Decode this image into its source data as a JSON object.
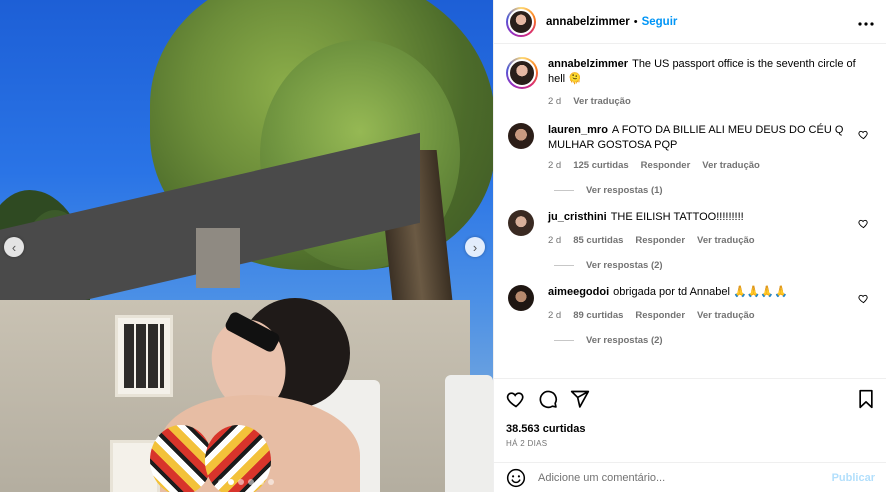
{
  "colors": {
    "accent": "#0095f6",
    "muted": "#737373",
    "publish_disabled": "#b2dffc"
  },
  "header": {
    "username": "annabelzimmer",
    "separator": "•",
    "follow_label": "Seguir",
    "more_icon": "more-horizontal-icon"
  },
  "caption": {
    "username": "annabelzimmer",
    "text": "The US passport office is the seventh circle of hell 🫠",
    "age": "2 d",
    "translate_label": "Ver tradução"
  },
  "comments": [
    {
      "username": "lauren_mro",
      "text": "A FOTO DA BILLIE ALI MEU DEUS DO CÉU Q MULHAR GOSTOSA PQP",
      "age": "2 d",
      "likes": "125 curtidas",
      "reply_label": "Responder",
      "translate_label": "Ver tradução",
      "replies_label": "Ver respostas (1)"
    },
    {
      "username": "ju_cristhini",
      "text": "THE EILISH TATTOO!!!!!!!!!",
      "age": "2 d",
      "likes": "85 curtidas",
      "reply_label": "Responder",
      "translate_label": "Ver tradução",
      "replies_label": "Ver respostas (2)"
    },
    {
      "username": "aimeegodoi",
      "text": "obrigada por td Annabel 🙏🙏🙏🙏",
      "age": "2 d",
      "likes": "89 curtidas",
      "reply_label": "Responder",
      "translate_label": "Ver tradução",
      "replies_label": "Ver respostas (2)"
    }
  ],
  "post": {
    "likes": "38.563 curtidas",
    "time": "HÁ 2 DIAS"
  },
  "add_comment": {
    "placeholder": "Adicione um comentário...",
    "publish_label": "Publicar"
  },
  "carousel": {
    "prev_icon": "‹",
    "next_icon": "›",
    "total_slides": 6,
    "active_slide": 2
  }
}
